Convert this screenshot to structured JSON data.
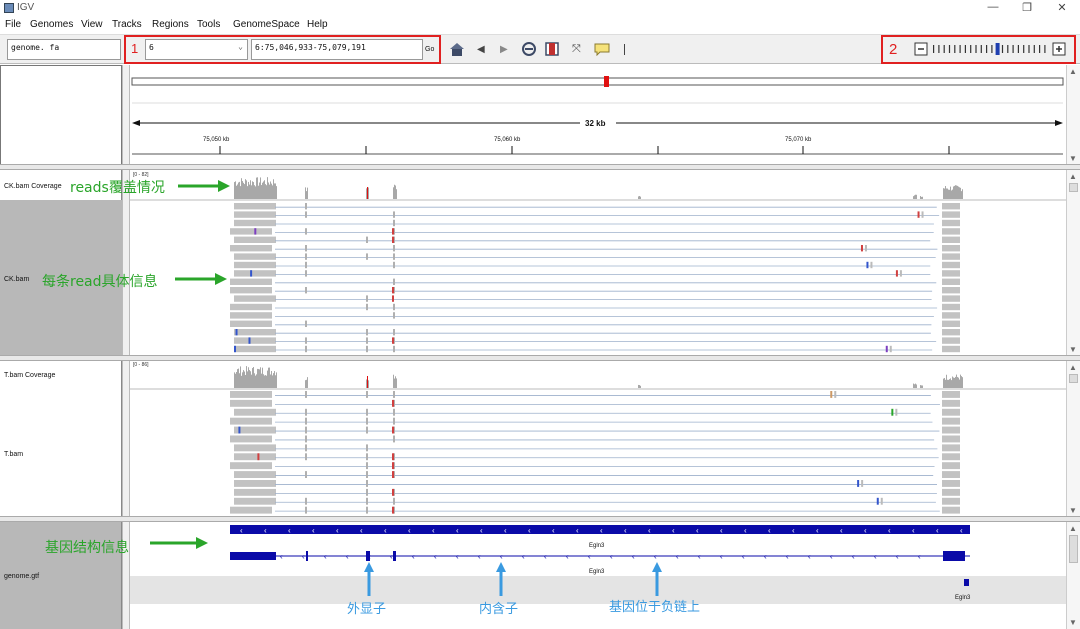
{
  "window": {
    "title": "IGV",
    "controls": [
      "—",
      "❐",
      "✕"
    ]
  },
  "menu": [
    "File",
    "Genomes",
    "View",
    "Tracks",
    "Regions",
    "Tools",
    "GenomeSpace",
    "Help"
  ],
  "toolbar": {
    "genome": "genome. fa",
    "chromosome": "6",
    "locus": "6:75,046,933-75,079,191",
    "go_label": "Go",
    "annot_1": "1",
    "annot_2": "2"
  },
  "ruler": {
    "span_label": "32 kb",
    "ticks": [
      "75,050 kb",
      "75,060 kb",
      "75,070 kb"
    ]
  },
  "tracks": {
    "ck_coverage": {
      "name": "CK.bam Coverage",
      "range": "[0 - 82]"
    },
    "ck_bam": {
      "name": "CK.bam"
    },
    "t_coverage": {
      "name": "T.bam Coverage",
      "range": "[0 - 86]"
    },
    "t_bam": {
      "name": "T.bam"
    },
    "gtf": {
      "name": "genome.gtf",
      "gene_labels": [
        "Egln3",
        "Egln3",
        "Egln3"
      ]
    }
  },
  "annotations": {
    "reads_coverage": "reads覆盖情况",
    "read_detail": "每条read具体信息",
    "gene_structure": "基因结构信息",
    "exon": "外显子",
    "intron": "内含子",
    "negative_strand": "基因位于负链上"
  },
  "colors": {
    "accent_red": "#e02020",
    "annotation_green": "#2aa52a",
    "annotation_blue": "#3a9ae0",
    "gene_blue": "#0a0aa8",
    "coverage_gray": "#a8a8a8",
    "read_gray": "#c2c2c2"
  }
}
